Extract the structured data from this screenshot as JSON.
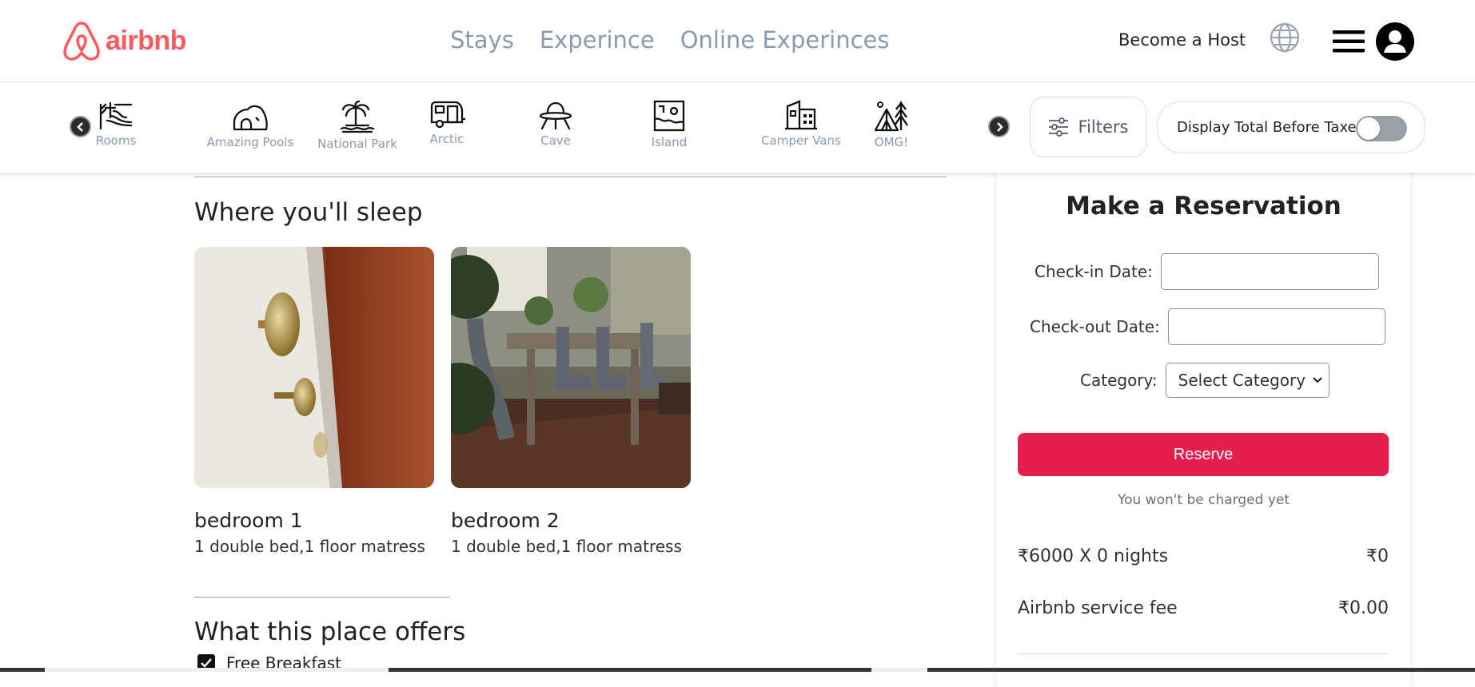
{
  "header": {
    "logo_text": "airbnb",
    "nav": [
      "Stays",
      "Experince",
      "Online Experinces"
    ],
    "become_host": "Become a Host"
  },
  "categories": [
    {
      "label": "Rooms",
      "icon": "rooms-icon"
    },
    {
      "label": "Amazing Pools",
      "icon": "pool-icon"
    },
    {
      "label": "National Park",
      "icon": "island-palm-icon"
    },
    {
      "label": "Arctic",
      "icon": "camper-icon"
    },
    {
      "label": "Cave",
      "icon": "ufo-icon"
    },
    {
      "label": "Island",
      "icon": "map-icon"
    },
    {
      "label": "Camper Vans",
      "icon": "buildings-icon"
    },
    {
      "label": "OMG!",
      "icon": "tent-icon"
    }
  ],
  "filters_label": "Filters",
  "taxes_label": "Display Total Before Taxes",
  "sleep": {
    "heading": "Where you'll sleep",
    "rooms": [
      {
        "name": "bedroom 1",
        "desc": "1 double bed,1 floor matress"
      },
      {
        "name": "bedroom 2",
        "desc": "1 double bed,1 floor matress"
      }
    ]
  },
  "offers": {
    "heading": "What this place offers",
    "items": [
      "Free Breakfast"
    ]
  },
  "reservation": {
    "title": "Make a Reservation",
    "checkin_label": "Check-in Date:",
    "checkout_label": "Check-out Date:",
    "category_label": "Category:",
    "category_value": "Select Category",
    "reserve_label": "Reserve",
    "note": "You won't be charged yet",
    "fees": [
      {
        "label": "₹6000 X 0 nights",
        "value": "₹0"
      },
      {
        "label": "Airbnb service fee",
        "value": "₹0.00"
      }
    ]
  },
  "colors": {
    "brand": "#ff5a5f",
    "reserve": "#e61e4d",
    "nav_text": "#8a9ab0"
  }
}
